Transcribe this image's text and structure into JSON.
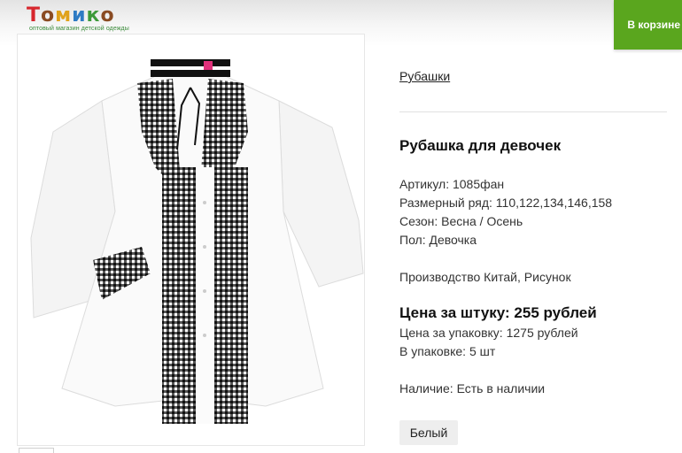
{
  "header": {
    "logo_letters": [
      "Т",
      "о",
      "м",
      "и",
      "к",
      "о"
    ],
    "logo_letter_colors": [
      "#d7262d",
      "#8a4b22",
      "#e0a21a",
      "#2e7bc4",
      "#3d9a3a",
      "#8a4b22"
    ],
    "logo_tagline": "оптовый магазин детской одежды",
    "cart_label": "В корзине"
  },
  "breadcrumb": {
    "category": "Рубашки"
  },
  "product": {
    "name": "Рубашка для девочек",
    "article": "Артикул: 1085фан",
    "sizes": "Размерный ряд: 110,122,134,146,158",
    "season": "Сезон: Весна / Осень",
    "gender": "Пол: Девочка",
    "production": "Производство Китай, Рисунок",
    "price_per_item": "Цена за штуку: 255 рублей",
    "price_per_pack": "Цена за упаковку: 1275 рублей",
    "pack_quantity": "В упаковке: 5 шт",
    "availability": "Наличие: Есть в наличии",
    "color_option": "Белый"
  },
  "colors": {
    "accent": "#5aa61e",
    "check_dark": "#1a1a1a",
    "shirt": "#f7f7f7"
  }
}
